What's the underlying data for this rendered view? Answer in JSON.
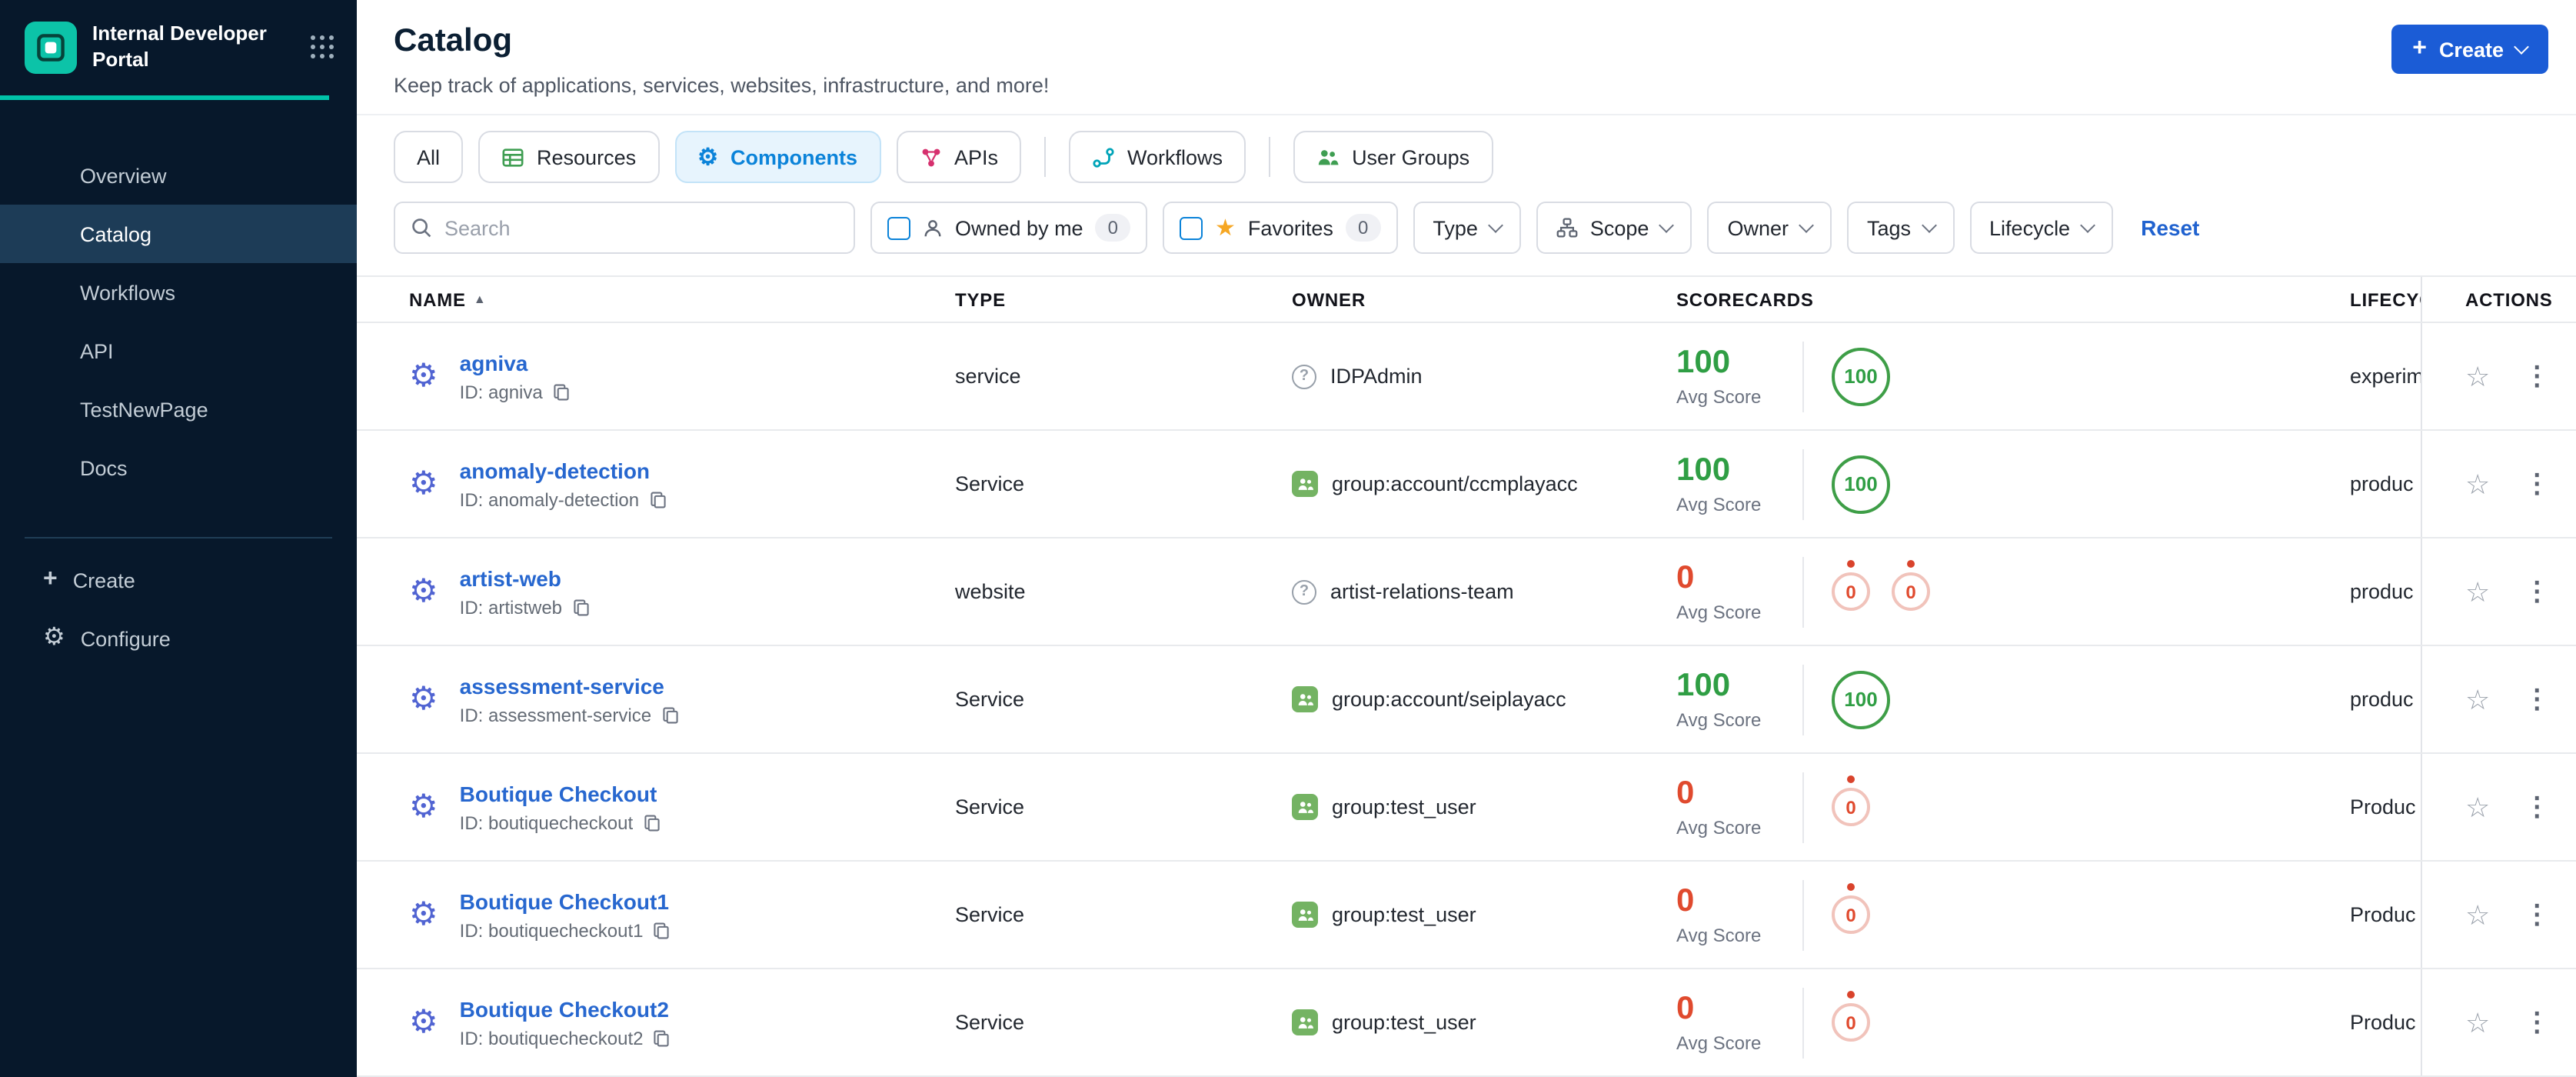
{
  "icons": {
    "sort_asc": "▲",
    "star_outline": "☆",
    "star_filled": "★",
    "kebab": "⋮",
    "gear": "⚙",
    "plus": "+"
  },
  "sidebar": {
    "logo_title": "Internal Developer Portal",
    "nav": [
      {
        "label": "Overview",
        "active": false
      },
      {
        "label": "Catalog",
        "active": true
      },
      {
        "label": "Workflows",
        "active": false
      },
      {
        "label": "API",
        "active": false
      },
      {
        "label": "TestNewPage",
        "active": false
      },
      {
        "label": "Docs",
        "active": false
      }
    ],
    "create_label": "Create",
    "configure_label": "Configure"
  },
  "header": {
    "title": "Catalog",
    "subtitle": "Keep track of applications, services, websites, infrastructure, and more!",
    "create_button_label": "Create"
  },
  "tabs": [
    {
      "label": "All"
    },
    {
      "label": "Resources",
      "icon": "resources"
    },
    {
      "label": "Components",
      "icon": "components",
      "active": true
    },
    {
      "label": "APIs",
      "icon": "apis"
    },
    {
      "divider": true
    },
    {
      "label": "Workflows",
      "icon": "workflows"
    },
    {
      "divider": true
    },
    {
      "label": "User Groups",
      "icon": "usergroups"
    }
  ],
  "filters": {
    "search_placeholder": "Search",
    "owned_by_me_label": "Owned by me",
    "owned_by_me_count": "0",
    "favorites_label": "Favorites",
    "favorites_count": "0",
    "dropdowns": [
      {
        "label": "Type"
      },
      {
        "label": "Scope",
        "icon": "scope"
      },
      {
        "label": "Owner"
      },
      {
        "label": "Tags"
      },
      {
        "label": "Lifecycle"
      }
    ],
    "reset_label": "Reset"
  },
  "table": {
    "columns": [
      "NAME",
      "TYPE",
      "OWNER",
      "SCORECARDS",
      "LIFECYC",
      "ACTIONS"
    ],
    "avg_score_label": "Avg Score",
    "rows": [
      {
        "name": "agniva",
        "id": "ID: agniva",
        "type": "service",
        "owner": "IDPAdmin",
        "owner_icon": "question",
        "score": "100",
        "score_color": "green",
        "badges": [
          {
            "value": "100",
            "size": "lg",
            "color": "green",
            "dot": false
          }
        ],
        "lifecycle": "experim"
      },
      {
        "name": "anomaly-detection",
        "id": "ID: anomaly-detection",
        "type": "Service",
        "owner": "group:account/ccmplayacc",
        "owner_icon": "group",
        "score": "100",
        "score_color": "green",
        "badges": [
          {
            "value": "100",
            "size": "lg",
            "color": "green",
            "dot": false
          }
        ],
        "lifecycle": "produc"
      },
      {
        "name": "artist-web",
        "id": "ID: artistweb",
        "type": "website",
        "owner": "artist-relations-team",
        "owner_icon": "question",
        "score": "0",
        "score_color": "red",
        "badges": [
          {
            "value": "0",
            "size": "sm",
            "color": "red",
            "dot": true
          },
          {
            "value": "0",
            "size": "sm",
            "color": "red",
            "dot": true
          }
        ],
        "lifecycle": "produc"
      },
      {
        "name": "assessment-service",
        "id": "ID: assessment-service",
        "type": "Service",
        "owner": "group:account/seiplayacc",
        "owner_icon": "group",
        "score": "100",
        "score_color": "green",
        "badges": [
          {
            "value": "100",
            "size": "lg",
            "color": "green",
            "dot": false
          }
        ],
        "lifecycle": "produc"
      },
      {
        "name": "Boutique Checkout",
        "id": "ID: boutiquecheckout",
        "type": "Service",
        "owner": "group:test_user",
        "owner_icon": "group",
        "score": "0",
        "score_color": "red",
        "badges": [
          {
            "value": "0",
            "size": "sm",
            "color": "red",
            "dot": true
          }
        ],
        "lifecycle": "Produc"
      },
      {
        "name": "Boutique Checkout1",
        "id": "ID: boutiquecheckout1",
        "type": "Service",
        "owner": "group:test_user",
        "owner_icon": "group",
        "score": "0",
        "score_color": "red",
        "badges": [
          {
            "value": "0",
            "size": "sm",
            "color": "red",
            "dot": true
          }
        ],
        "lifecycle": "Produc"
      },
      {
        "name": "Boutique Checkout2",
        "id": "ID: boutiquecheckout2",
        "type": "Service",
        "owner": "group:test_user",
        "owner_icon": "group",
        "score": "0",
        "score_color": "red",
        "badges": [
          {
            "value": "0",
            "size": "sm",
            "color": "red",
            "dot": true
          }
        ],
        "lifecycle": "Produc"
      }
    ]
  },
  "colors": {
    "accent_blue": "#1b5cd6",
    "link_blue": "#2767cf",
    "tab_blue": "#0b83d9",
    "green": "#2f9e44",
    "red": "#e04a2e",
    "sidebar_bg": "#07182b",
    "teal_accent": "#00c2a8"
  }
}
